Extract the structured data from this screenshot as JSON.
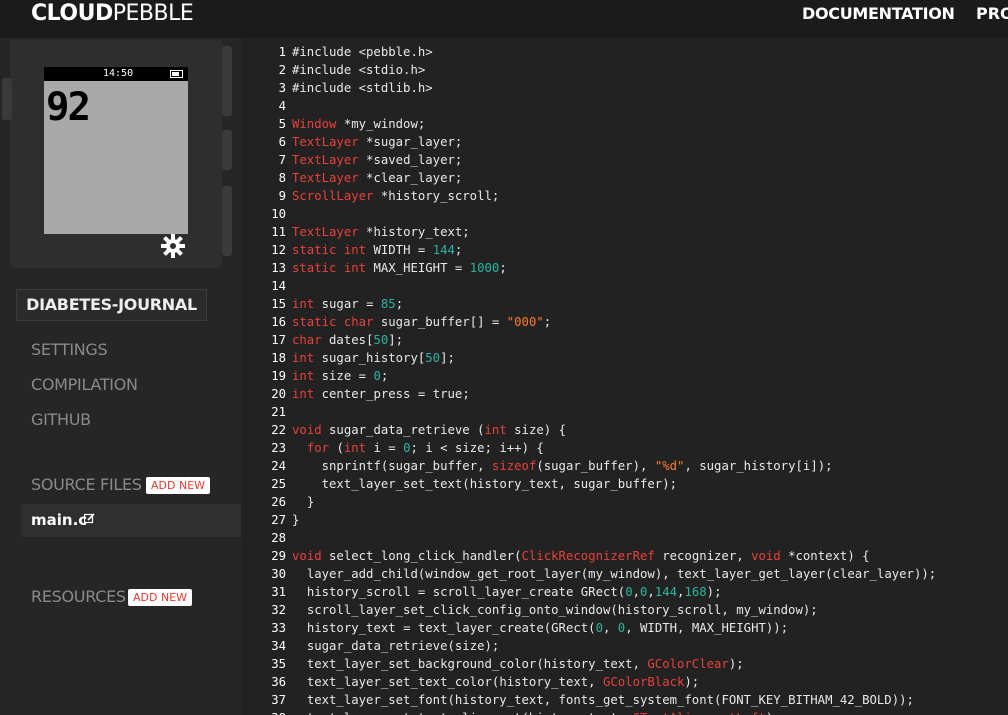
{
  "topbar": {
    "logo_bold": "CLOUD",
    "logo_rest": "PEBBLE",
    "nav": [
      "DOCUMENTATION",
      "PRO"
    ]
  },
  "emulator": {
    "time": "14:50",
    "sugar_display": "92",
    "settings_icon": "gear-icon"
  },
  "sidebar": {
    "project_name": "DIABETES-JOURNAL",
    "links": [
      "SETTINGS",
      "COMPILATION",
      "GITHUB"
    ],
    "source_files_label": "SOURCE FILES",
    "add_new": "ADD NEW",
    "files": [
      "main.c"
    ],
    "resources_label": "RESOURCES"
  },
  "editor": {
    "lines": [
      "#include <pebble.h>",
      "#include <stdio.h>",
      "#include <stdlib.h>",
      "",
      "Window *my_window;",
      "TextLayer *sugar_layer;",
      "TextLayer *saved_layer;",
      "TextLayer *clear_layer;",
      "ScrollLayer *history_scroll;",
      "",
      "TextLayer *history_text;",
      "static int WIDTH = 144;",
      "static int MAX_HEIGHT = 1000;",
      "",
      "int sugar = 85;",
      "static char sugar_buffer[] = \"000\";",
      "char dates[50];",
      "int sugar_history[50];",
      "int size = 0;",
      "int center_press = true;",
      "",
      "void sugar_data_retrieve (int size) {",
      "  for (int i = 0; i < size; i++) {",
      "    snprintf(sugar_buffer, sizeof(sugar_buffer), \"%d\", sugar_history[i]);",
      "    text_layer_set_text(history_text, sugar_buffer);",
      "  }",
      "}",
      "",
      "void select_long_click_handler(ClickRecognizerRef recognizer, void *context) {",
      "  layer_add_child(window_get_root_layer(my_window), text_layer_get_layer(clear_layer));",
      "  history_scroll = scroll_layer_create GRect(0,0,144,168);",
      "  scroll_layer_set_click_config_onto_window(history_scroll, my_window);",
      "  history_text = text_layer_create(GRect(0, 0, WIDTH, MAX_HEIGHT));",
      "  sugar_data_retrieve(size);",
      "  text_layer_set_background_color(history_text, GColorClear);",
      "  text_layer_set_text_color(history_text, GColorBlack);",
      "  text_layer_set_font(history_text, fonts_get_system_font(FONT_KEY_BITHAM_42_BOLD));",
      "  text_layer_set_text_alignment(history_text, GTextAlignmentLeft);"
    ]
  },
  "colors": {
    "keyword": "#e8413a",
    "number": "#2bb5a0",
    "string": "#ff7a2a",
    "background": "#222222"
  }
}
